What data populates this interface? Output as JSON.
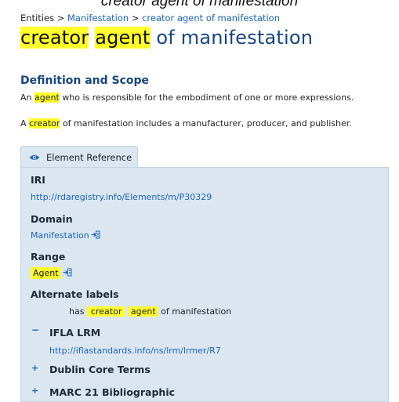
{
  "caption": "creator agent of manifestation",
  "breadcrumb": {
    "root": "Entities",
    "sep1": ">",
    "level1": "Manifestation",
    "sep2": ">",
    "current": "creator agent of manifestation"
  },
  "title": {
    "word1": "creator",
    "word2": "agent",
    "rest": "of manifestation"
  },
  "definition": {
    "heading": "Definition and Scope",
    "line1_prefix": "An",
    "line1_highlight": "agent",
    "line1_rest": "who is responsible for the embodiment of one or more expressions.",
    "line2_prefix": "A",
    "line2_highlight": "creator",
    "line2_rest": "of manifestation includes a manufacturer, producer, and publisher."
  },
  "element_reference": {
    "tab_label": "Element Reference",
    "iri_label": "IRI",
    "iri_value": "http://rdaregistry.info/Elements/m/P30329",
    "domain_label": "Domain",
    "domain_value": "Manifestation",
    "range_label": "Range",
    "range_value": "Agent",
    "alt_labels_label": "Alternate labels",
    "alt_label_prefix": "has",
    "alt_label_hl1": "creator",
    "alt_label_hl2": "agent",
    "alt_label_rest": "of manifestation",
    "ifla_toggle": "−",
    "ifla_label": "IFLA LRM",
    "ifla_link": "http://iflastandards.info/ns/lrm/lrmer/R7",
    "dublin_toggle": "+",
    "dublin_label": "Dublin Core Terms",
    "marc_toggle": "+",
    "marc_label": "MARC 21 Bibliographic"
  },
  "colors": {
    "highlight": "#ffff2e",
    "link": "#1a64b6",
    "heading": "#17457f",
    "panel_bg": "#dbe6f1"
  },
  "icons": {
    "tab": "eye-icon",
    "domain": "enter-icon",
    "range": "enter-icon"
  }
}
